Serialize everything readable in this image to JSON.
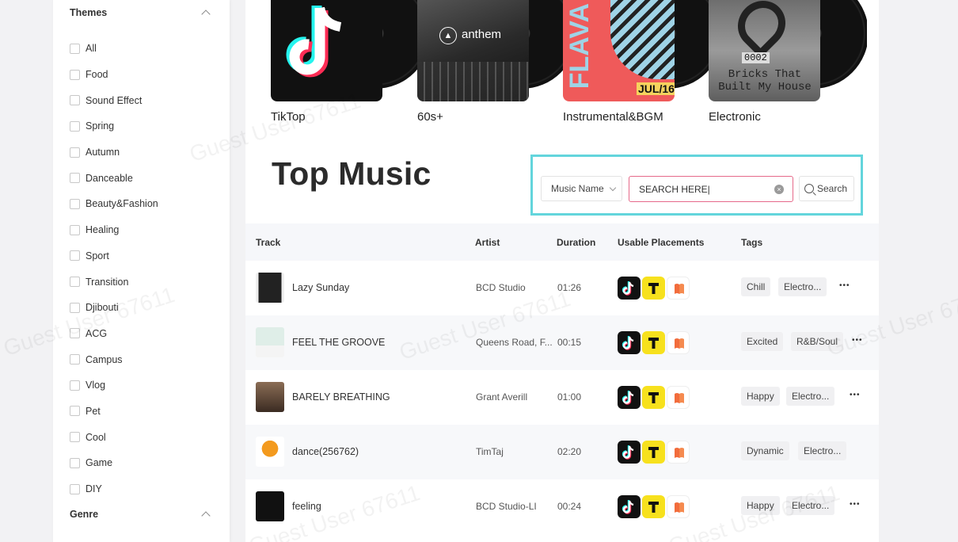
{
  "sidebar": {
    "themes_heading": "Themes",
    "themes": [
      "All",
      "Food",
      "Sound Effect",
      "Spring",
      "Autumn",
      "Danceable",
      "Beauty&Fashion",
      "Healing",
      "Sport",
      "Transition",
      "Djibouti",
      "ACG",
      "Campus",
      "Vlog",
      "Pet",
      "Cool",
      "Game",
      "DIY"
    ],
    "genre_heading": "Genre"
  },
  "categories": [
    {
      "label": "TikTop",
      "art_text": ""
    },
    {
      "label": "60s+",
      "art_text": "anthem"
    },
    {
      "label": "Instrumental&BGM",
      "art_text": "JUL/16"
    },
    {
      "label": "Electronic",
      "art_text": "Bricks That Built My House"
    }
  ],
  "page_title": "Top Music",
  "search": {
    "filter_selected": "Music Name",
    "input_value": "SEARCH HERE|",
    "button_label": "Search"
  },
  "table": {
    "headers": {
      "track": "Track",
      "artist": "Artist",
      "duration": "Duration",
      "placements": "Usable Placements",
      "tags": "Tags"
    },
    "rows": [
      {
        "track": "Lazy Sunday",
        "artist": "BCD Studio",
        "duration": "01:26",
        "tags": [
          "Chill",
          "Electro..."
        ]
      },
      {
        "track": "FEEL THE GROOVE",
        "artist": "Queens Road, F...",
        "duration": "00:15",
        "tags": [
          "Excited",
          "R&B/Soul"
        ]
      },
      {
        "track": "BARELY BREATHING",
        "artist": "Grant Averill",
        "duration": "01:00",
        "tags": [
          "Happy",
          "Electro..."
        ]
      },
      {
        "track": "dance(256762)",
        "artist": "TimTaj",
        "duration": "02:20",
        "tags": [
          "Dynamic",
          "Electro..."
        ]
      },
      {
        "track": "feeling",
        "artist": "BCD Studio-LI",
        "duration": "00:24",
        "tags": [
          "Happy",
          "Electro..."
        ]
      }
    ]
  },
  "watermark": "Guest User 67611",
  "colors": {
    "highlight": "#63d5dc",
    "input_border": "#e66a8a",
    "tiktok": "#111111",
    "t_badge": "#f7e11d",
    "bookmark": "#f26c3c"
  }
}
